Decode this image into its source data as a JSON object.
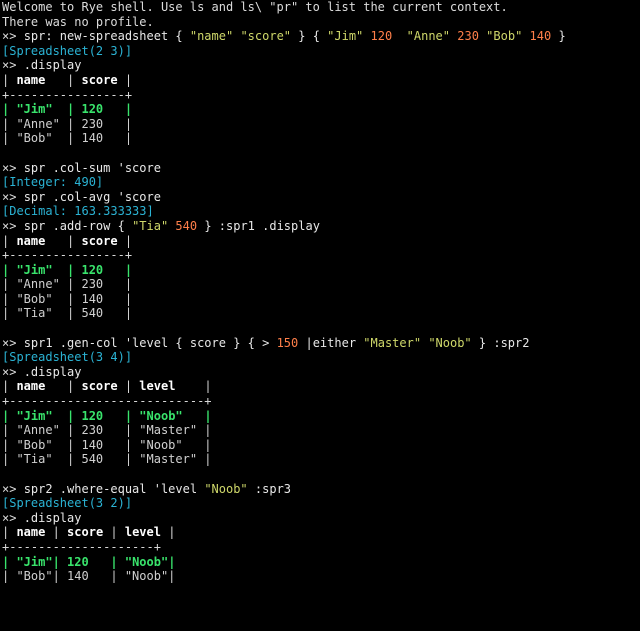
{
  "colors": {
    "background": "#000000",
    "text": "#dcdcdc",
    "string": "#cfd86a",
    "number": "#ff7f4a",
    "type_result": "#2bb3d4",
    "highlight_row": "#39e46c"
  },
  "lines": [
    [
      {
        "t": "Welcome to Rye shell. Use ls and ls\\ \"pr\" to list the current context.",
        "c": "default"
      }
    ],
    [
      {
        "t": "There was no profile.",
        "c": "default"
      }
    ],
    [
      {
        "t": "×> ",
        "c": "prompt"
      },
      {
        "t": "spr: new-spreadsheet { ",
        "c": "cmd"
      },
      {
        "t": "\"name\"",
        "c": "str"
      },
      {
        "t": " ",
        "c": "cmd"
      },
      {
        "t": "\"score\"",
        "c": "str"
      },
      {
        "t": " } { ",
        "c": "cmd"
      },
      {
        "t": "\"Jim\"",
        "c": "str"
      },
      {
        "t": " ",
        "c": "cmd"
      },
      {
        "t": "120",
        "c": "num"
      },
      {
        "t": "  ",
        "c": "cmd"
      },
      {
        "t": "\"Anne\"",
        "c": "str"
      },
      {
        "t": " ",
        "c": "cmd"
      },
      {
        "t": "230",
        "c": "num"
      },
      {
        "t": " ",
        "c": "cmd"
      },
      {
        "t": "\"Bob\"",
        "c": "str"
      },
      {
        "t": " ",
        "c": "cmd"
      },
      {
        "t": "140",
        "c": "num"
      },
      {
        "t": " }",
        "c": "cmd"
      }
    ],
    [
      {
        "t": "[Spreadsheet(2 3)]",
        "c": "type"
      }
    ],
    [
      {
        "t": "×> ",
        "c": "prompt"
      },
      {
        "t": ".display",
        "c": "cmd"
      }
    ],
    [
      {
        "t": "| ",
        "c": "border"
      },
      {
        "t": "name",
        "c": "head"
      },
      {
        "t": "   | ",
        "c": "border"
      },
      {
        "t": "score",
        "c": "head"
      },
      {
        "t": " |",
        "c": "border"
      }
    ],
    [
      {
        "t": "+----------------+",
        "c": "border"
      }
    ],
    [
      {
        "t": "| ",
        "c": "hl"
      },
      {
        "t": "\"Jim\"",
        "c": "hl"
      },
      {
        "t": "  | ",
        "c": "hl"
      },
      {
        "t": "120",
        "c": "hl"
      },
      {
        "t": "   |",
        "c": "hl"
      }
    ],
    [
      {
        "t": "| \"Anne\" | 230   |",
        "c": "cell"
      }
    ],
    [
      {
        "t": "| \"Bob\"  | 140   |",
        "c": "cell"
      }
    ],
    [
      {
        "t": "",
        "c": "default"
      }
    ],
    [
      {
        "t": "×> ",
        "c": "prompt"
      },
      {
        "t": "spr .col-sum 'score",
        "c": "cmd"
      }
    ],
    [
      {
        "t": "[Integer: 490]",
        "c": "type"
      }
    ],
    [
      {
        "t": "×> ",
        "c": "prompt"
      },
      {
        "t": "spr .col-avg 'score",
        "c": "cmd"
      }
    ],
    [
      {
        "t": "[Decimal: 163.333333]",
        "c": "type"
      }
    ],
    [
      {
        "t": "×> ",
        "c": "prompt"
      },
      {
        "t": "spr .add-row { ",
        "c": "cmd"
      },
      {
        "t": "\"Tia\"",
        "c": "str"
      },
      {
        "t": " ",
        "c": "cmd"
      },
      {
        "t": "540",
        "c": "num"
      },
      {
        "t": " } :spr1 .display",
        "c": "cmd"
      }
    ],
    [
      {
        "t": "| ",
        "c": "border"
      },
      {
        "t": "name",
        "c": "head"
      },
      {
        "t": "   | ",
        "c": "border"
      },
      {
        "t": "score",
        "c": "head"
      },
      {
        "t": " |",
        "c": "border"
      }
    ],
    [
      {
        "t": "+----------------+",
        "c": "border"
      }
    ],
    [
      {
        "t": "| ",
        "c": "hl"
      },
      {
        "t": "\"Jim\"",
        "c": "hl"
      },
      {
        "t": "  | ",
        "c": "hl"
      },
      {
        "t": "120",
        "c": "hl"
      },
      {
        "t": "   |",
        "c": "hl"
      }
    ],
    [
      {
        "t": "| \"Anne\" | 230   |",
        "c": "cell"
      }
    ],
    [
      {
        "t": "| \"Bob\"  | 140   |",
        "c": "cell"
      }
    ],
    [
      {
        "t": "| \"Tia\"  | 540   |",
        "c": "cell"
      }
    ],
    [
      {
        "t": "",
        "c": "default"
      }
    ],
    [
      {
        "t": "×> ",
        "c": "prompt"
      },
      {
        "t": "spr1 .gen-col 'level { score } { > ",
        "c": "cmd"
      },
      {
        "t": "150",
        "c": "num"
      },
      {
        "t": " |either ",
        "c": "cmd"
      },
      {
        "t": "\"Master\"",
        "c": "str"
      },
      {
        "t": " ",
        "c": "cmd"
      },
      {
        "t": "\"Noob\"",
        "c": "str"
      },
      {
        "t": " } :spr2",
        "c": "cmd"
      }
    ],
    [
      {
        "t": "[Spreadsheet(3 4)]",
        "c": "type"
      }
    ],
    [
      {
        "t": "×> ",
        "c": "prompt"
      },
      {
        "t": ".display",
        "c": "cmd"
      }
    ],
    [
      {
        "t": "| ",
        "c": "border"
      },
      {
        "t": "name",
        "c": "head"
      },
      {
        "t": "   | ",
        "c": "border"
      },
      {
        "t": "score",
        "c": "head"
      },
      {
        "t": " | ",
        "c": "border"
      },
      {
        "t": "level",
        "c": "head"
      },
      {
        "t": "    |",
        "c": "border"
      }
    ],
    [
      {
        "t": "+---------------------------+",
        "c": "border"
      }
    ],
    [
      {
        "t": "| ",
        "c": "hl"
      },
      {
        "t": "\"Jim\"",
        "c": "hl"
      },
      {
        "t": "  | ",
        "c": "hl"
      },
      {
        "t": "120",
        "c": "hl"
      },
      {
        "t": "   | ",
        "c": "hl"
      },
      {
        "t": "\"Noob\"",
        "c": "hl"
      },
      {
        "t": "   |",
        "c": "hl"
      }
    ],
    [
      {
        "t": "| \"Anne\" | 230   | \"Master\" |",
        "c": "cell"
      }
    ],
    [
      {
        "t": "| \"Bob\"  | 140   | \"Noob\"   |",
        "c": "cell"
      }
    ],
    [
      {
        "t": "| \"Tia\"  | 540   | \"Master\" |",
        "c": "cell"
      }
    ],
    [
      {
        "t": "",
        "c": "default"
      }
    ],
    [
      {
        "t": "×> ",
        "c": "prompt"
      },
      {
        "t": "spr2 .where-equal 'level ",
        "c": "cmd"
      },
      {
        "t": "\"Noob\"",
        "c": "str"
      },
      {
        "t": " :spr3",
        "c": "cmd"
      }
    ],
    [
      {
        "t": "[Spreadsheet(3 2)]",
        "c": "type"
      }
    ],
    [
      {
        "t": "×> ",
        "c": "prompt"
      },
      {
        "t": ".display",
        "c": "cmd"
      }
    ],
    [
      {
        "t": "| ",
        "c": "border"
      },
      {
        "t": "name",
        "c": "head"
      },
      {
        "t": " | ",
        "c": "border"
      },
      {
        "t": "score",
        "c": "head"
      },
      {
        "t": " | ",
        "c": "border"
      },
      {
        "t": "level",
        "c": "head"
      },
      {
        "t": " |",
        "c": "border"
      }
    ],
    [
      {
        "t": "+--------------------+",
        "c": "border"
      }
    ],
    [
      {
        "t": "| ",
        "c": "hl"
      },
      {
        "t": "\"Jim\"",
        "c": "hl"
      },
      {
        "t": "| ",
        "c": "hl"
      },
      {
        "t": "120",
        "c": "hl"
      },
      {
        "t": "   | ",
        "c": "hl"
      },
      {
        "t": "\"Noob\"",
        "c": "hl"
      },
      {
        "t": "|",
        "c": "hl"
      }
    ],
    [
      {
        "t": "| \"Bob\"| 140   | \"Noob\"|",
        "c": "cell"
      }
    ]
  ]
}
